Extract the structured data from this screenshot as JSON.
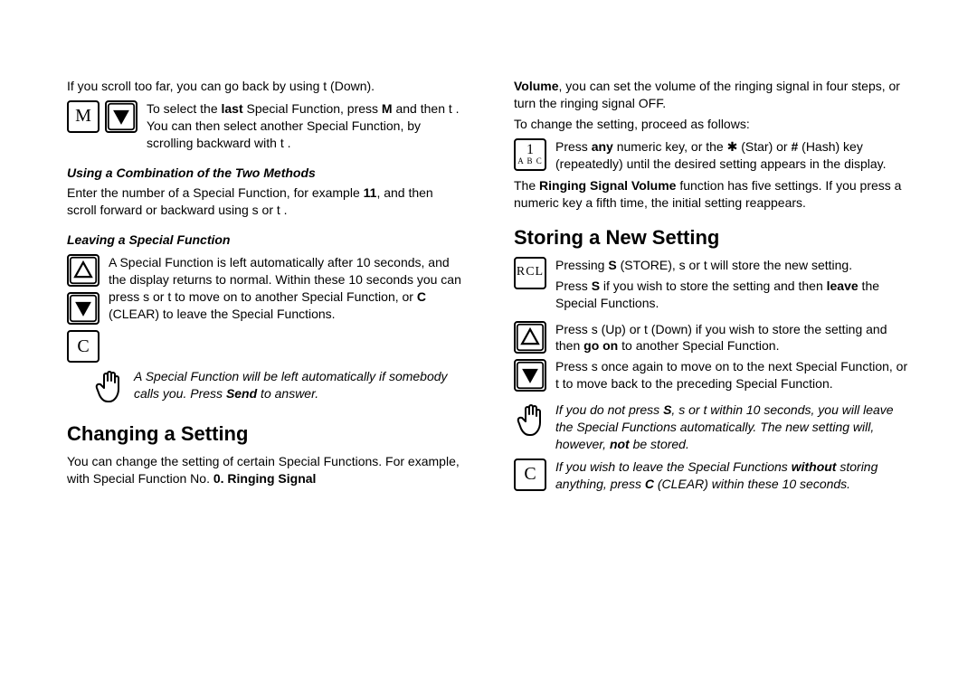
{
  "left": {
    "p1a": "If you scroll too far, you can go back by using ",
    "p1b": " (Down).",
    "p2a": "To select the ",
    "p2b": "last",
    "p2c": " Special Function, press ",
    "p2d": "M",
    "p2e": " and then ",
    "p2f": " . You can then select another Special Function, by scrolling backward with ",
    "p2g": " .",
    "h3a": "Using a Combination of the Two Methods",
    "p3a": "Enter the number of a Special Function, for example ",
    "p3b": "11",
    "p3c": ", and then scroll forward or backward using ",
    "p3d": " or ",
    "p3e": " .",
    "h3b": "Leaving a Special Function",
    "p4a": "A Special Function is left automatically after 10 seconds, and the display returns to normal. Within these 10 seconds you can press ",
    "p4b": " or ",
    "p4c": " to move on to another Special Function, or ",
    "p4d": "C",
    "p4e": " (CLEAR) to leave the Special Functions.",
    "note1a": "A Special Function will be left automatically if somebody calls you. Press ",
    "note1b": "Send",
    "note1c": " to answer.",
    "h2a": "Changing a Setting",
    "p5a": "You can change the setting of certain Special Functions. For example, with Special Function No. ",
    "p5b": "0. Ringing Signal "
  },
  "right": {
    "p1a": "Volume",
    "p1b": ", you can set the volume of the ringing signal in four steps, or turn the ringing signal OFF.",
    "p2": "To change the setting, proceed as follows:",
    "p3a": "Press ",
    "p3b": "any",
    "p3c": " numeric key, or the ",
    "p3d": " (Star) or ",
    "p3e": "#",
    "p3f": " (Hash) key (repeatedly) until the desired setting appears in the display.",
    "p4a": "The ",
    "p4b": "Ringing Signal Volume",
    "p4c": " function has five settings. If you press a numeric key a fifth time, the initial setting reappears.",
    "h2a": "Storing a New Setting",
    "p5a": "Pressing ",
    "p5b": "S",
    "p5c": " (STORE), ",
    "p5d": " or ",
    "p5e": " will store the new setting.",
    "p6a": "Press ",
    "p6b": "S",
    "p6c": " if you wish to store the setting and then ",
    "p6d": "leave",
    "p6e": " the Special Functions.",
    "p7a": "Press ",
    "p7b": " (Up) or ",
    "p7c": " (Down) if you wish to store the setting and then ",
    "p7d": "go on",
    "p7e": " to another Special Function.",
    "p8a": "Press ",
    "p8b": " once again to move on to the next Special Function, or ",
    "p8c": " to move back to the preceding Special Function.",
    "note2a": "If you do not press ",
    "note2b": "S",
    "note2c": ", ",
    "note2d": " or ",
    "note2e": " within 10 seconds, you will leave the Special Functions automatically. The new setting will, however, ",
    "note2f": "not",
    "note2g": " be stored.",
    "note3a": "If you wish to leave the Special Functions ",
    "note3b": "without",
    "note3c": " storing anything, press ",
    "note3d": "C",
    "note3e": " (CLEAR) within these 10 seconds.",
    "symbols": {
      "s": "s",
      "t": "t",
      "star": "✱"
    }
  },
  "keys": {
    "M": "M",
    "C": "C",
    "RCL": "RCL",
    "one": "1",
    "abc": "A B C"
  }
}
